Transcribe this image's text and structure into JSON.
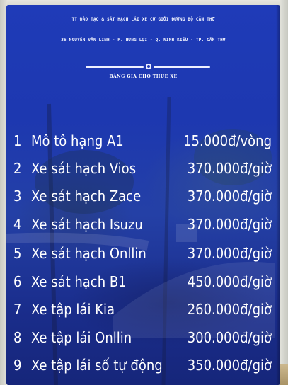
{
  "sign": {
    "header_line1": "TT ĐÀO TẠO & SÁT HẠCH LÁI XE CƠ GIỚI ĐƯỜNG BỘ CẦN THƠ",
    "header_line2": "36 NGUYỄN VĂN LINH - P. HƯNG LỢI - Q. NINH KIỀU - TP. CẦN THƠ",
    "title": "BẢNG GIÁ CHO THUÊ XE",
    "items": [
      {
        "num": "1",
        "name": "Mô tô hạng A1",
        "price": "15.000đ/vòng"
      },
      {
        "num": "2",
        "name": "Xe sát hạch Vios",
        "price": "370.000đ/giờ"
      },
      {
        "num": "3",
        "name": "Xe sát hạch Zace",
        "price": "370.000đ/giờ"
      },
      {
        "num": "4",
        "name": "Xe sát hạch Isuzu",
        "price": "370.000đ/giờ"
      },
      {
        "num": "5",
        "name": "Xe sát hạch Onllin",
        "price": "370.000đ/giờ"
      },
      {
        "num": "6",
        "name": "Xe sát hạch B1",
        "price": "450.000đ/giờ"
      },
      {
        "num": "7",
        "name": "Xe tập lái Kia",
        "price": "260.000đ/giờ"
      },
      {
        "num": "8",
        "name": "Xe tập lái Onllin",
        "price": "300.000đ/giờ"
      },
      {
        "num": "9",
        "name": "Xe tập lái số tự động",
        "price": "350.000đ/giờ"
      }
    ],
    "colors": {
      "board": "#1f3bb8",
      "text": "#ffffff",
      "wall": "#d9dad3"
    }
  }
}
